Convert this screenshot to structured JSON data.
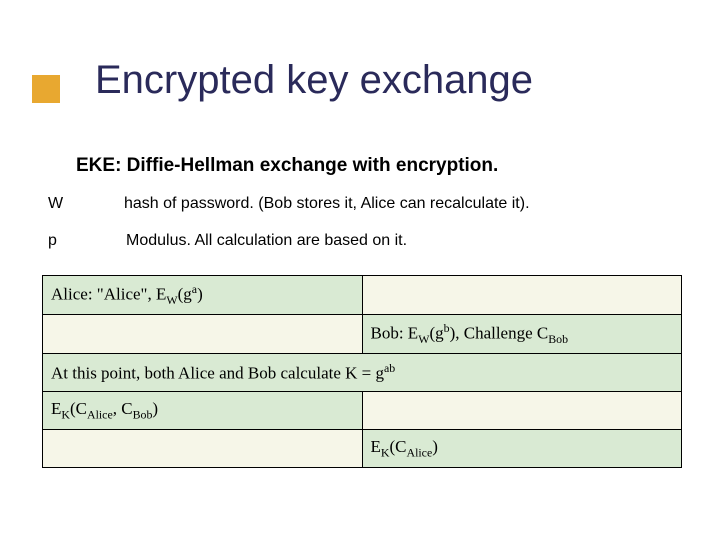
{
  "title": "Encrypted key exchange",
  "subtitle": "EKE: Diffie-Hellman exchange with encryption.",
  "defs": {
    "W": {
      "symbol": "W",
      "text": "hash of password. (Bob stores it, Alice can recalculate it)."
    },
    "p": {
      "symbol": "p",
      "text": "Modulus.  All calculation are based on it."
    }
  },
  "proto": {
    "row1_alice_prefix": "Alice: \"Alice\", E",
    "row1_alice_sub": "W",
    "row1_alice_g": "(g",
    "row1_alice_exp": "a",
    "row1_alice_close": ")",
    "row2_bob_prefix": "Bob: E",
    "row2_bob_sub": "W",
    "row2_bob_g": "(g",
    "row2_bob_exp": "b",
    "row2_bob_mid": "), Challenge C",
    "row2_bob_sub2": "Bob",
    "row3_prefix": "At this point, both Alice and Bob calculate K = g",
    "row3_exp": "ab",
    "row4_prefix": "E",
    "row4_sub1": "K",
    "row4_open": "(C",
    "row4_sub2": "Alice",
    "row4_mid": ", C",
    "row4_sub3": "Bob",
    "row4_close": ")",
    "row5_prefix": "E",
    "row5_sub1": "K",
    "row5_open": "(C",
    "row5_sub2": "Alice",
    "row5_close": ")"
  }
}
